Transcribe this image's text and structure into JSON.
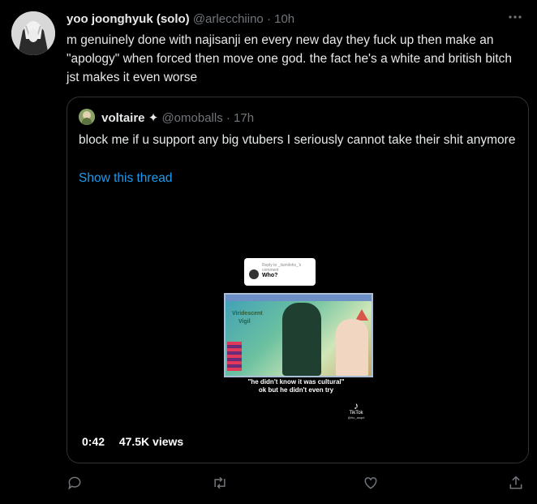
{
  "tweet": {
    "display_name": "yoo joonghyuk (solo)",
    "handle": "@arlecchiino",
    "time": "· 10h",
    "text": "m genuinely done with najisanji en every new day they fuck up then make an \"apology\" when forced then move one god. the fact he's a white and british bitch jst makes it even worse"
  },
  "quote": {
    "display_name": "voltaire",
    "badge": "✦",
    "handle": "@omoballs",
    "time": "· 17h",
    "text": "block me if u support any big vtubers I seriously cannot take their shit anymore",
    "thread_link": "Show this thread",
    "video": {
      "duration": "0:42",
      "views": "47.5K views",
      "comment_reply_text": "Reply to _ilumilohs_'s comment",
      "comment_text": "Who?",
      "game_label_1": "Viridescent",
      "game_label_2": "Vigil",
      "caption": "\"he didn't know it was cultural\" ok but he didn't even try",
      "watermark": "TikTok",
      "watermark_handle": "@fro_anqel"
    }
  },
  "colors": {
    "background": "#000000",
    "text": "#e7e9ea",
    "muted": "#71767b",
    "link": "#1d9bf0",
    "border": "#2f3336"
  },
  "icons": [
    "more-icon",
    "reply-icon",
    "retweet-icon",
    "like-icon",
    "share-icon"
  ]
}
